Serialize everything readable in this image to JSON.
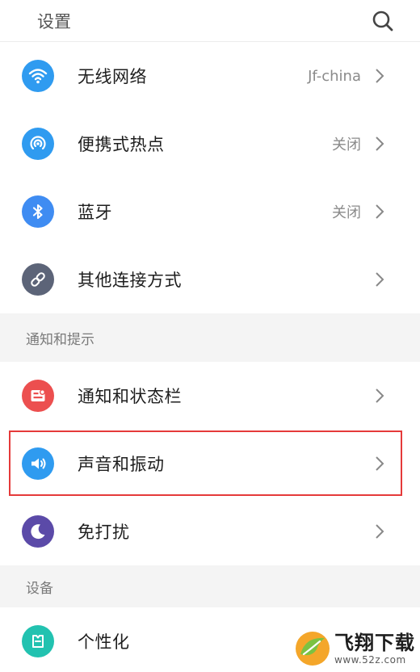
{
  "header": {
    "title": "设置",
    "search_icon": "search-icon"
  },
  "connections": [
    {
      "id": "wifi",
      "label": "无线网络",
      "value": "Jf-china",
      "icon": "wifi-icon",
      "color": "#2f9bf0"
    },
    {
      "id": "hotspot",
      "label": "便携式热点",
      "value": "关闭",
      "icon": "hotspot-icon",
      "color": "#2f9bf0"
    },
    {
      "id": "bluetooth",
      "label": "蓝牙",
      "value": "关闭",
      "icon": "bluetooth-icon",
      "color": "#3f8cf2"
    },
    {
      "id": "other-connections",
      "label": "其他连接方式",
      "value": "",
      "icon": "link-icon",
      "color": "#5c6478"
    }
  ],
  "notifications_section": {
    "title": "通知和提示",
    "items": [
      {
        "id": "notification-status-bar",
        "label": "通知和状态栏",
        "icon": "notification-icon",
        "color": "#ec4f4f"
      },
      {
        "id": "sound-vibration",
        "label": "声音和振动",
        "icon": "speaker-icon",
        "color": "#2f9bf0"
      },
      {
        "id": "do-not-disturb",
        "label": "免打扰",
        "icon": "moon-icon",
        "color": "#5b4aa8"
      }
    ]
  },
  "device_section": {
    "title": "设备",
    "items": [
      {
        "id": "personalization",
        "label": "个性化",
        "icon": "personalization-icon",
        "color": "#22c2b0"
      }
    ]
  },
  "watermark": {
    "main": "飞翔下载",
    "url": "www.52z.com"
  },
  "highlight_color": "#e53a3a"
}
